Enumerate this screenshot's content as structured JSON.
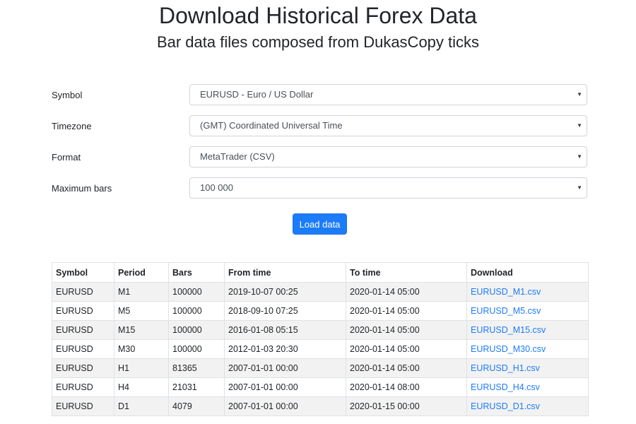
{
  "header": {
    "title": "Download Historical Forex Data",
    "subtitle": "Bar data files composed from DukasCopy ticks"
  },
  "form": {
    "symbol": {
      "label": "Symbol",
      "value": "EURUSD - Euro / US Dollar"
    },
    "timezone": {
      "label": "Timezone",
      "value": "(GMT) Coordinated Universal Time"
    },
    "format": {
      "label": "Format",
      "value": "MetaTrader (CSV)"
    },
    "max_bars": {
      "label": "Maximum bars",
      "value": "100 000"
    },
    "caret": "▼",
    "load_button": "Load data"
  },
  "table": {
    "headers": [
      "Symbol",
      "Period",
      "Bars",
      "From time",
      "To time",
      "Download"
    ],
    "rows": [
      [
        "EURUSD",
        "M1",
        "100000",
        "2019-10-07 00:25",
        "2020-01-14 05:00",
        "EURUSD_M1.csv"
      ],
      [
        "EURUSD",
        "M5",
        "100000",
        "2018-09-10 07:25",
        "2020-01-14 05:00",
        "EURUSD_M5.csv"
      ],
      [
        "EURUSD",
        "M15",
        "100000",
        "2016-01-08 05:15",
        "2020-01-14 05:00",
        "EURUSD_M15.csv"
      ],
      [
        "EURUSD",
        "M30",
        "100000",
        "2012-01-03 20:30",
        "2020-01-14 05:00",
        "EURUSD_M30.csv"
      ],
      [
        "EURUSD",
        "H1",
        "81365",
        "2007-01-01 00:00",
        "2020-01-14 05:00",
        "EURUSD_H1.csv"
      ],
      [
        "EURUSD",
        "H4",
        "21031",
        "2007-01-01 00:00",
        "2020-01-14 08:00",
        "EURUSD_H4.csv"
      ],
      [
        "EURUSD",
        "D1",
        "4079",
        "2007-01-01 00:00",
        "2020-01-15 00:00",
        "EURUSD_D1.csv"
      ]
    ]
  },
  "colors": {
    "accent": "#1c7cf8",
    "stripe": "#f2f2f2",
    "border": "#dee2e6"
  }
}
